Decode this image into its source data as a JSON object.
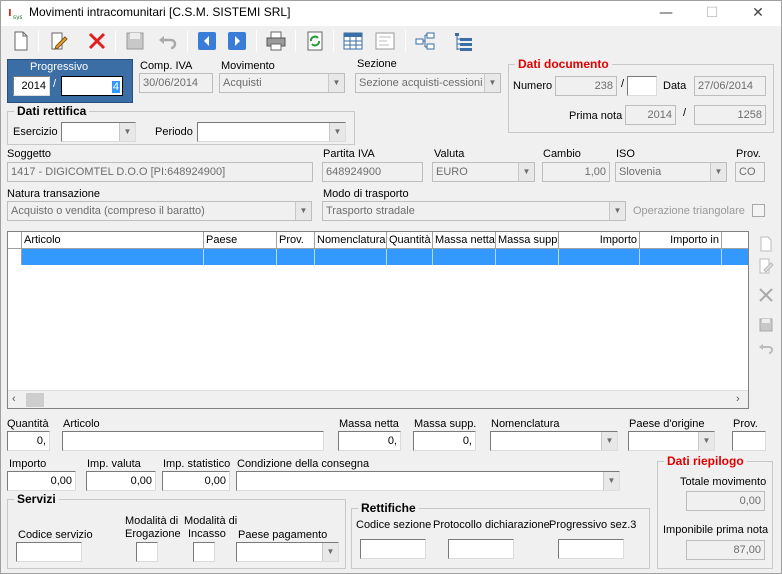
{
  "window": {
    "title": "Movimenti intracomunitari [C.S.M. SISTEMI SRL]",
    "minimize": "—",
    "maximize": "☐",
    "close": "✕"
  },
  "toolbar": {
    "icons": [
      "new-document-icon",
      "edit-icon",
      "delete-icon",
      "save-icon",
      "undo-icon",
      "previous-icon",
      "next-icon",
      "print-icon",
      "refresh-icon",
      "grid-view-icon",
      "form-view-icon",
      "hierarchy-icon",
      "list-tree-icon"
    ]
  },
  "header": {
    "progressivo_label": "Progressivo",
    "progressivo_year": "2014",
    "progressivo_sep": "/",
    "progressivo_num": "4",
    "comp_iva_label": "Comp. IVA",
    "comp_iva_value": "30/06/2014",
    "movimento_label": "Movimento",
    "movimento_value": "Acquisti",
    "sezione_label": "Sezione",
    "sezione_value": "Sezione acquisti-cessioni"
  },
  "dati_documento": {
    "title": "Dati documento",
    "numero_label": "Numero",
    "numero_value": "238",
    "sep": "/",
    "numero_suffix": "",
    "data_label": "Data",
    "data_value": "27/06/2014",
    "prima_nota_label": "Prima nota",
    "prima_nota_year": "2014",
    "prima_nota_sep": "/",
    "prima_nota_num": "1258"
  },
  "dati_rettifica": {
    "title": "Dati rettifica",
    "esercizio_label": "Esercizio",
    "esercizio_value": "",
    "periodo_label": "Periodo",
    "periodo_value": ""
  },
  "soggetto": {
    "soggetto_label": "Soggetto",
    "soggetto_value": "1417 - DIGICOMTEL D.O.O [PI:648924900]",
    "piva_label": "Partita IVA",
    "piva_value": "648924900",
    "valuta_label": "Valuta",
    "valuta_value": "EURO",
    "cambio_label": "Cambio",
    "cambio_value": "1,00",
    "iso_label": "ISO",
    "iso_value": "Slovenia",
    "prov_label": "Prov.",
    "prov_value": "CO"
  },
  "transazione": {
    "natura_label": "Natura transazione",
    "natura_value": "Acquisto o vendita (compreso il baratto)",
    "trasporto_label": "Modo di trasporto",
    "trasporto_value": "Trasporto stradale",
    "triangolare_label": "Operazione triangolare"
  },
  "grid": {
    "columns": [
      "Articolo",
      "Paese",
      "Prov.",
      "Nomenclatura",
      "Quantità",
      "Massa netta",
      "Massa supp.",
      "Importo",
      "Importo in"
    ]
  },
  "riga": {
    "quantita_label": "Quantità",
    "quantita_value": "0,",
    "articolo_label": "Articolo",
    "articolo_value": "",
    "massa_netta_label": "Massa netta",
    "massa_netta_value": "0,",
    "massa_supp_label": "Massa supp.",
    "massa_supp_value": "0,",
    "nomenclatura_label": "Nomenclatura",
    "nomenclatura_value": "",
    "paese_origine_label": "Paese d'origine",
    "paese_origine_value": "",
    "prov_label": "Prov.",
    "prov_value": "",
    "importo_label": "Importo",
    "importo_value": "0,00",
    "imp_valuta_label": "Imp. valuta",
    "imp_valuta_value": "0,00",
    "imp_statistico_label": "Imp. statistico",
    "imp_statistico_value": "0,00",
    "condizione_label": "Condizione della consegna",
    "condizione_value": ""
  },
  "servizi": {
    "title": "Servizi",
    "codice_label": "Codice servizio",
    "erogazione_label_1": "Modalità di",
    "erogazione_label_2": "Erogazione",
    "incasso_label_1": "Modalità di",
    "incasso_label_2": "Incasso",
    "paese_pag_label": "Paese pagamento"
  },
  "rettifiche": {
    "title": "Rettifiche",
    "codice_sezione_label": "Codice sezione",
    "protocollo_label": "Protocollo dichiarazione",
    "progressivo_label": "Progressivo sez.3"
  },
  "riepilogo": {
    "title": "Dati riepilogo",
    "totale_label": "Totale movimento",
    "totale_value": "0,00",
    "imponibile_label": "Imponibile prima nota",
    "imponibile_value": "87,00"
  },
  "colors": {
    "accent_blue": "#3399ff",
    "header_blue": "#3a6ea5",
    "title_red": "#e00000"
  }
}
